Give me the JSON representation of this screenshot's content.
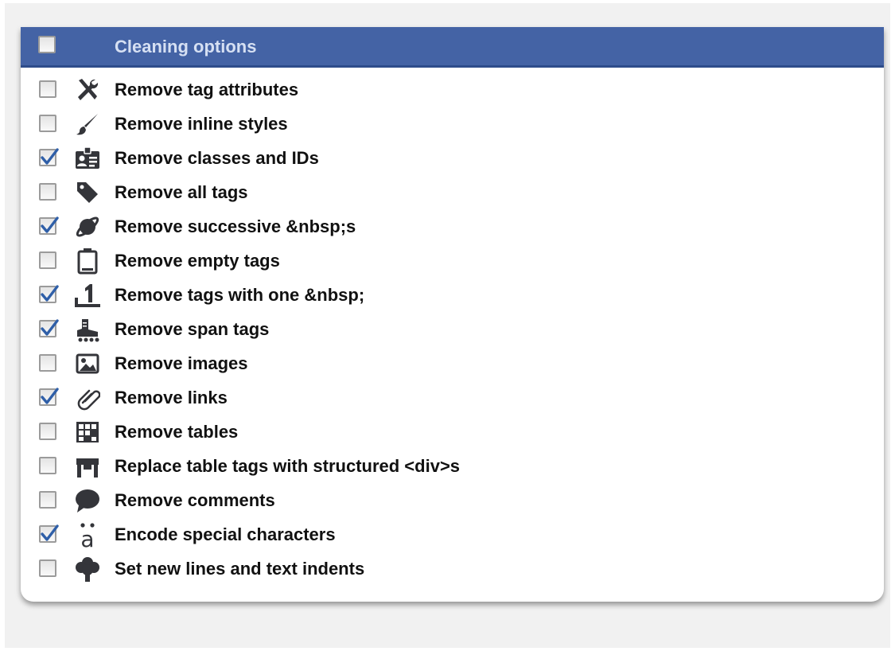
{
  "panel": {
    "title": "Cleaning options",
    "header_checked": false,
    "options": [
      {
        "label": "Remove tag attributes",
        "checked": false,
        "icon": "tools-icon"
      },
      {
        "label": "Remove inline styles",
        "checked": false,
        "icon": "brush-icon"
      },
      {
        "label": "Remove classes and IDs",
        "checked": true,
        "icon": "id-card-icon"
      },
      {
        "label": "Remove all tags",
        "checked": false,
        "icon": "tag-icon"
      },
      {
        "label": "Remove successive &nbsp;s",
        "checked": true,
        "icon": "planet-icon"
      },
      {
        "label": "Remove empty tags",
        "checked": false,
        "icon": "battery-empty-icon"
      },
      {
        "label": "Remove tags with one &nbsp;",
        "checked": true,
        "icon": "number-one-icon"
      },
      {
        "label": "Remove span tags",
        "checked": true,
        "icon": "roller-skate-icon"
      },
      {
        "label": "Remove images",
        "checked": false,
        "icon": "image-icon"
      },
      {
        "label": "Remove links",
        "checked": true,
        "icon": "link-icon"
      },
      {
        "label": "Remove tables",
        "checked": false,
        "icon": "table-icon"
      },
      {
        "label": "Replace table tags with structured <div>s",
        "checked": false,
        "icon": "furniture-table-icon"
      },
      {
        "label": "Remove comments",
        "checked": false,
        "icon": "speech-bubble-icon"
      },
      {
        "label": "Encode special characters",
        "checked": true,
        "icon": "a-umlaut-icon"
      },
      {
        "label": "Set new lines and text indents",
        "checked": false,
        "icon": "tree-icon"
      }
    ]
  },
  "colors": {
    "header_bg": "#4463a5",
    "header_text": "#d6e0f3",
    "check_mark": "#2f5fa8",
    "icon": "#34353a"
  }
}
